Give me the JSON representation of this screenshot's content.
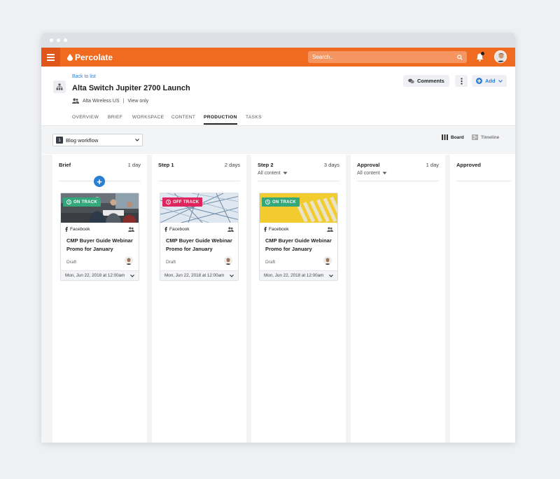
{
  "app": {
    "brand": "Percolate",
    "search_placeholder": "Search..",
    "colors": {
      "accent": "#f06a1f",
      "link": "#2a7fd4",
      "on_track": "#34a77c",
      "off_track": "#e0245e"
    }
  },
  "header": {
    "back_link": "Back to list",
    "title": "Alta Switch Jupiter 2700 Launch",
    "team": "Alta Wireless US",
    "separator": "|",
    "permission": "View only",
    "comments_label": "Comments",
    "add_label": "Add"
  },
  "tabs": [
    {
      "label": "OVERVIEW"
    },
    {
      "label": "BRIEF"
    },
    {
      "label": "WORKSPACE"
    },
    {
      "label": "CONTENT"
    },
    {
      "label": "PRODUCTION",
      "active": true
    },
    {
      "label": "TASKS"
    }
  ],
  "toolbar": {
    "workflow_num": "1",
    "workflow_label": "Blog workflow",
    "board_label": "Board",
    "timeline_label": "Timeline"
  },
  "columns": [
    {
      "name": "Brief",
      "days": "1 day"
    },
    {
      "name": "Step 1",
      "days": "2 days"
    },
    {
      "name": "Step 2",
      "days": "3 days",
      "filter": "All content"
    },
    {
      "name": "Approval",
      "days": "1 day",
      "filter": "All content"
    },
    {
      "name": "Approved",
      "days": ""
    }
  ],
  "cards": [
    {
      "status": "ON TRACK",
      "channel": "Facebook",
      "title": "CMP Buyer Guide Webinar Promo for January",
      "state": "Draft",
      "date": "Mon, Jun 22, 2018 at 12:00am"
    },
    {
      "status": "OFF TRACK",
      "channel": "Facebook",
      "title": "CMP Buyer Guide Webinar Promo for January",
      "state": "Draft",
      "date": "Mon, Jun 22, 2018 at 12:00am"
    },
    {
      "status": "ON TRACK",
      "channel": "Facebook",
      "title": "CMP Buyer Guide Webinar Promo for January",
      "state": "Draft",
      "date": "Mon, Jun 22, 2018 at 12:00am"
    }
  ]
}
